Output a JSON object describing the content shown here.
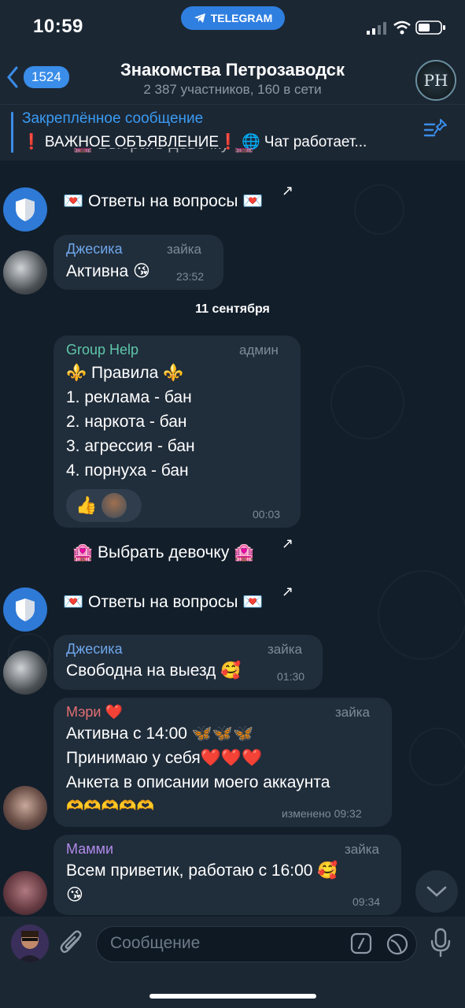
{
  "status": {
    "time": "10:59",
    "app_pill": "TELEGRAM"
  },
  "header": {
    "back_count": "1524",
    "title": "Знакомства Петрозаводск",
    "subtitle": "2 387 участников, 160 в сети",
    "avatar_text": "PH"
  },
  "pinned": {
    "title": "Закреплённое сообщение",
    "text": "❗ ВАЖНОЕ ОБЪЯВЛЕНИЕ❗ 🌐 Чат работает..."
  },
  "buttons": {
    "answers_label": "💌 Ответы на вопросы 💌",
    "choose_label": "🏩 Выбрать девочку 🏩"
  },
  "messages": [
    {
      "sender": "Джесика",
      "role": "зайка",
      "text": "Активна 😘",
      "time": "23:52"
    },
    {
      "sender": "Group Help",
      "role": "админ",
      "lines": [
        "⚜️ Правила ⚜️",
        "1. реклама - бан",
        "2. наркота - бан",
        "3. агрессия - бан",
        "4. порнуха -  бан"
      ],
      "time": "00:03",
      "reaction": "👍"
    },
    {
      "sender": "Джесика",
      "role": "зайка",
      "text": "Свободна на выезд 🥰",
      "time": "01:30"
    },
    {
      "sender": "Мэри ❤️",
      "role": "зайка",
      "lines": [
        "Активна с 14:00 🦋🦋🦋",
        "Принимаю у себя❤️❤️❤️",
        "Анкета в описании моего аккаунта",
        "🫶🫶🫶🫶🫶"
      ],
      "time": "изменено 09:32"
    },
    {
      "sender": "Мамми",
      "role": "зайка",
      "lines": [
        "Всем приветик, работаю с 16:00 🥰",
        "😘"
      ],
      "time": "09:34"
    }
  ],
  "date_separator": "11 сентября",
  "input": {
    "placeholder": "Сообщение"
  },
  "colors": {
    "accent": "#3a8de8",
    "jessica": "#6fa6ea",
    "grouphelp": "#5ec7a9",
    "mary": "#e36f72",
    "mammi": "#b18bea"
  }
}
